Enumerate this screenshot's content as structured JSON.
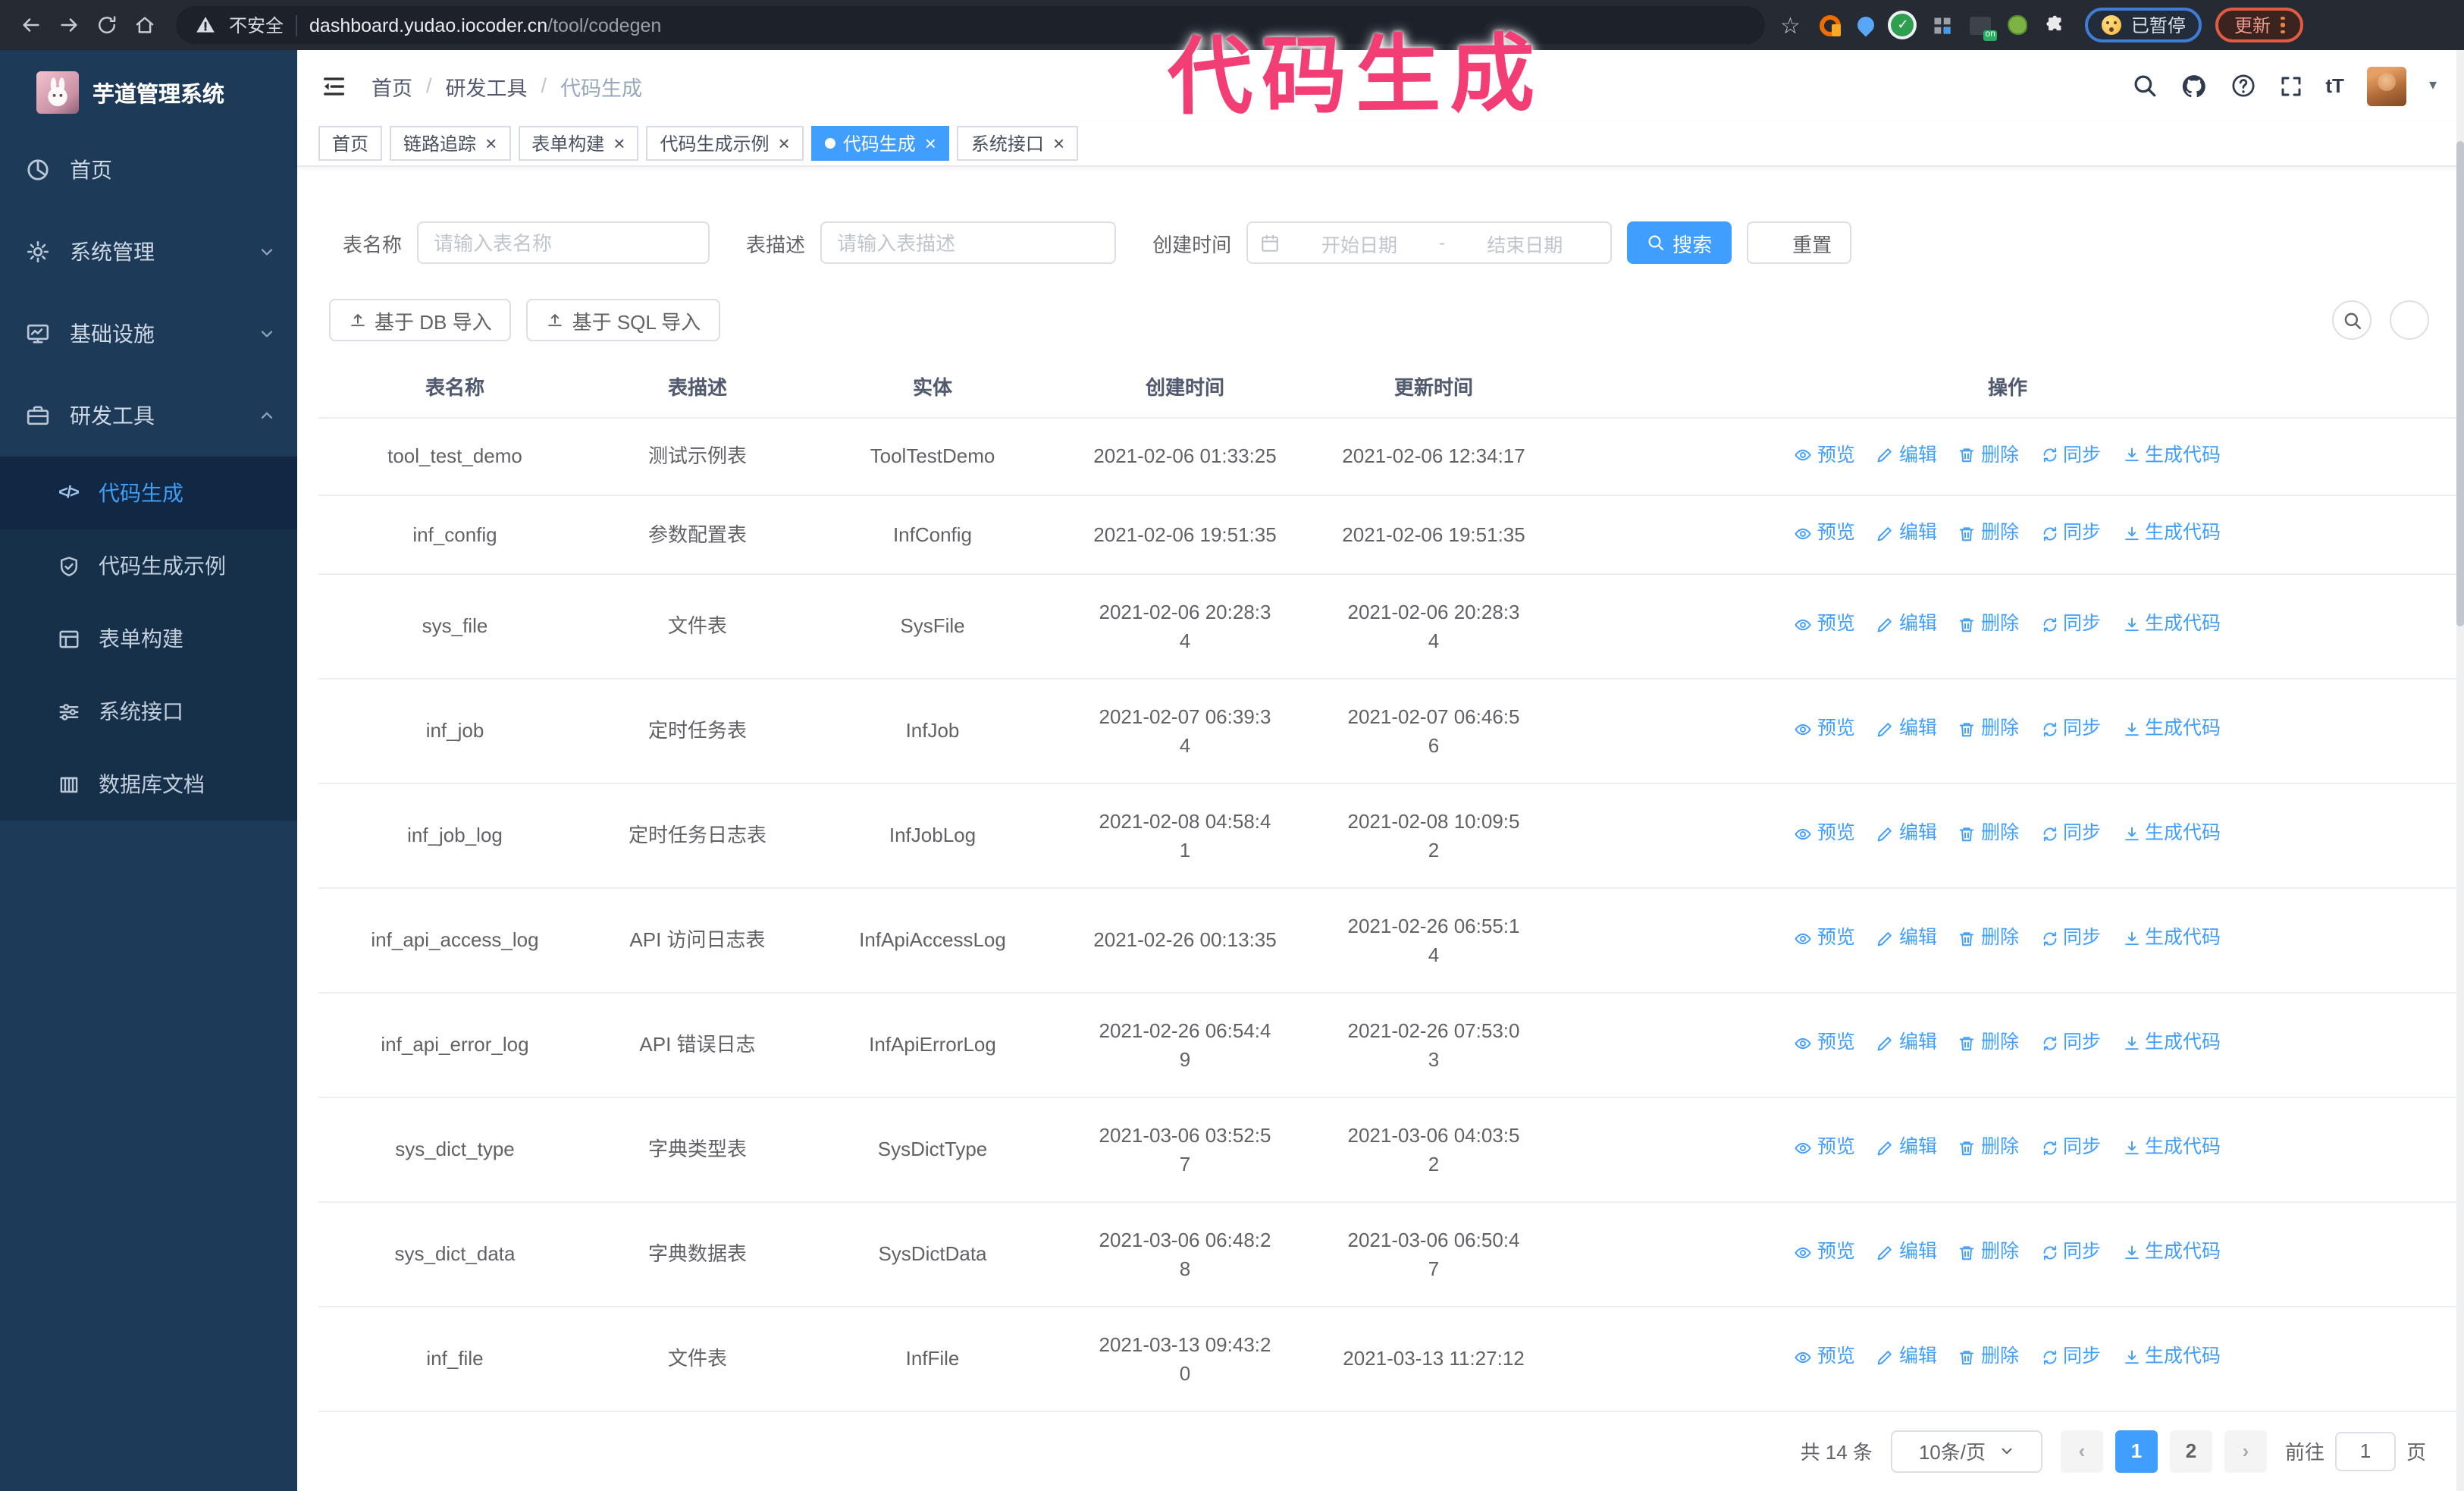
{
  "colors": {
    "accent": "#409eff",
    "annotation": "#f23e74",
    "sidebar_bg": "#1d3b58",
    "submenu_bg": "#16304a"
  },
  "annotation": {
    "text": "代码生成"
  },
  "browser": {
    "security_label": "不安全",
    "url_host": "dashboard.yudao.iocoder.cn",
    "url_path": "/tool/codegen",
    "extensions": [
      "orange-ring-extension-icon",
      "blue-drop-extension-icon",
      "green-check-extension-icon",
      "gray-grid-extension-icon",
      "dark-on-extension-icon",
      "green-dot-extension-icon",
      "puzzle-extension-icon"
    ],
    "paused_badge": "已暂停",
    "update_button": "更新"
  },
  "sidebar": {
    "title": "芋道管理系统",
    "items": [
      {
        "label": "首页",
        "icon": "dashboard-icon"
      },
      {
        "label": "系统管理",
        "icon": "gear-icon",
        "chevron": "down"
      },
      {
        "label": "基础设施",
        "icon": "monitor-icon",
        "chevron": "down"
      },
      {
        "label": "研发工具",
        "icon": "toolbox-icon",
        "chevron": "up"
      }
    ],
    "submenu": [
      {
        "label": "代码生成",
        "icon": "code-icon",
        "active": true
      },
      {
        "label": "代码生成示例",
        "icon": "shield-check-icon"
      },
      {
        "label": "表单构建",
        "icon": "form-icon"
      },
      {
        "label": "系统接口",
        "icon": "sliders-icon"
      },
      {
        "label": "数据库文档",
        "icon": "database-icon"
      }
    ]
  },
  "breadcrumb": [
    "首页",
    "研发工具",
    "代码生成"
  ],
  "tags": [
    {
      "label": "首页",
      "closable": false,
      "active": false
    },
    {
      "label": "链路追踪",
      "closable": true,
      "active": false
    },
    {
      "label": "表单构建",
      "closable": true,
      "active": false
    },
    {
      "label": "代码生成示例",
      "closable": true,
      "active": false
    },
    {
      "label": "代码生成",
      "closable": true,
      "active": true
    },
    {
      "label": "系统接口",
      "closable": true,
      "active": false
    }
  ],
  "search": {
    "name_label": "表名称",
    "name_placeholder": "请输入表名称",
    "desc_label": "表描述",
    "desc_placeholder": "请输入表描述",
    "time_label": "创建时间",
    "start_placeholder": "开始日期",
    "range_separator": "-",
    "end_placeholder": "结束日期",
    "search_button": "搜索",
    "reset_button": "重置"
  },
  "toolbar": {
    "db_import": "基于 DB 导入",
    "sql_import": "基于 SQL 导入"
  },
  "table": {
    "columns": [
      "表名称",
      "表描述",
      "实体",
      "创建时间",
      "更新时间",
      "操作"
    ],
    "actions": [
      "预览",
      "编辑",
      "删除",
      "同步",
      "生成代码"
    ],
    "rows": [
      {
        "name": "tool_test_demo",
        "desc": "测试示例表",
        "entity": "ToolTestDemo",
        "created": "2021-02-06 01:33:25",
        "updated": "2021-02-06 12:34:17"
      },
      {
        "name": "inf_config",
        "desc": "参数配置表",
        "entity": "InfConfig",
        "created": "2021-02-06 19:51:35",
        "updated": "2021-02-06 19:51:35"
      },
      {
        "name": "sys_file",
        "desc": "文件表",
        "entity": "SysFile",
        "created": "2021-02-06 20:28:3\n4",
        "updated": "2021-02-06 20:28:3\n4"
      },
      {
        "name": "inf_job",
        "desc": "定时任务表",
        "entity": "InfJob",
        "created": "2021-02-07 06:39:3\n4",
        "updated": "2021-02-07 06:46:5\n6"
      },
      {
        "name": "inf_job_log",
        "desc": "定时任务日志表",
        "entity": "InfJobLog",
        "created": "2021-02-08 04:58:4\n1",
        "updated": "2021-02-08 10:09:5\n2"
      },
      {
        "name": "inf_api_access_log",
        "desc": "API 访问日志表",
        "entity": "InfApiAccessLog",
        "created": "2021-02-26 00:13:35",
        "updated": "2021-02-26 06:55:1\n4"
      },
      {
        "name": "inf_api_error_log",
        "desc": "API 错误日志",
        "entity": "InfApiErrorLog",
        "created": "2021-02-26 06:54:4\n9",
        "updated": "2021-02-26 07:53:0\n3"
      },
      {
        "name": "sys_dict_type",
        "desc": "字典类型表",
        "entity": "SysDictType",
        "created": "2021-03-06 03:52:5\n7",
        "updated": "2021-03-06 04:03:5\n2"
      },
      {
        "name": "sys_dict_data",
        "desc": "字典数据表",
        "entity": "SysDictData",
        "created": "2021-03-06 06:48:2\n8",
        "updated": "2021-03-06 06:50:4\n7"
      },
      {
        "name": "inf_file",
        "desc": "文件表",
        "entity": "InfFile",
        "created": "2021-03-13 09:43:2\n0",
        "updated": "2021-03-13 11:27:12"
      }
    ]
  },
  "pagination": {
    "total": "共 14 条",
    "page_size": "10条/页",
    "pages": [
      "1",
      "2"
    ],
    "active_page": "1",
    "goto_label": "前往",
    "goto_value": "1",
    "page_suffix": "页"
  }
}
